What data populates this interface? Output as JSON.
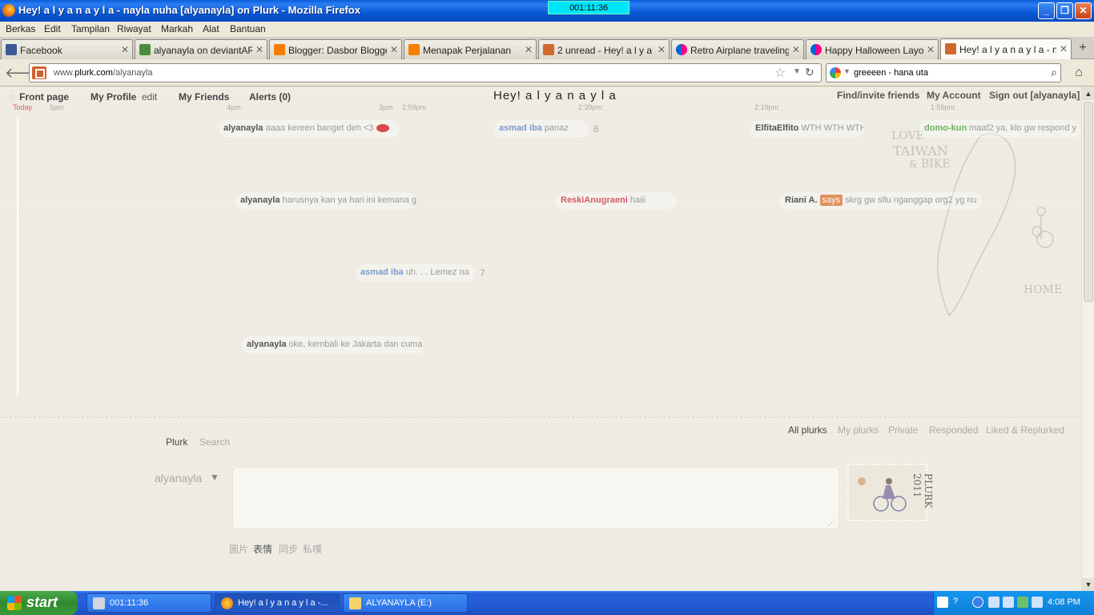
{
  "window": {
    "title": "Hey! a l y a n a y l a - nayla nuha [alyanayla] on Plurk - Mozilla Firefox",
    "timer": "001:11:36"
  },
  "menu": [
    "Berkas",
    "Edit",
    "Tampilan",
    "Riwayat",
    "Markah",
    "Alat",
    "Bantuan"
  ],
  "tabs": [
    {
      "label": "Facebook",
      "icon": "facebook-icon",
      "color": "#3b5998"
    },
    {
      "label": "alyanayla on deviantART",
      "icon": "deviantart-icon",
      "color": "#4a8c3b"
    },
    {
      "label": "Blogger: Dasbor Blogger",
      "icon": "blogger-icon",
      "color": "#f57d00"
    },
    {
      "label": "Menapak Perjalanan",
      "icon": "blogger-icon",
      "color": "#f57d00"
    },
    {
      "label": "2 unread - Hey! a l y a ...",
      "icon": "plurk-icon",
      "color": "#cf682f"
    },
    {
      "label": "Retro Airplane traveling...",
      "icon": "flickr-icon",
      "color": "#ff0084"
    },
    {
      "label": "Happy Halloween Layou...",
      "icon": "flickr-icon",
      "color": "#ff0084"
    },
    {
      "label": "Hey! a l y a n a y l a - n...",
      "icon": "plurk-icon",
      "color": "#cf682f"
    }
  ],
  "nav": {
    "url_prefix": "www.",
    "url_host": "plurk.com",
    "url_path": "/alyanayla",
    "search_value": "greeeen - hana uta"
  },
  "plurk": {
    "nav": {
      "front_page": "Front page",
      "my_profile": "My Profile",
      "edit": "edit",
      "my_friends": "My Friends",
      "alerts": "Alerts (0)"
    },
    "page_title": "Hey! a l y a n a y l a",
    "account_links": {
      "find_friends": "Find/invite friends",
      "my_account": "My Account",
      "sign_out": "Sign out [alyanayla]"
    },
    "timeline": {
      "today": "Today",
      "labels": [
        "5pm",
        "4pm",
        "3pm",
        "2:59pm",
        "2:39pm",
        "2:19pm",
        "1:59pm"
      ]
    },
    "plurks": [
      {
        "name": "alyanayla",
        "text": "aaaa kereen banget deh <3",
        "style": "normal",
        "count": ""
      },
      {
        "name": "asmad iba",
        "text": "panaz",
        "style": "blue",
        "count": "6"
      },
      {
        "name": "ElfitaElfito",
        "text": "WTH WTH WTH",
        "style": "normal",
        "count": ""
      },
      {
        "name": "domo-kun",
        "text": "maaf2 ya, klo gw respond y",
        "style": "green",
        "count": ""
      },
      {
        "name": "alyanayla",
        "text": "harusnya kan ya hari ini kemana g",
        "style": "normal",
        "count": ""
      },
      {
        "name": "ReskiAnugraeni",
        "text": "haiii",
        "style": "red",
        "count": ""
      },
      {
        "name": "Riani A.",
        "verb": "says",
        "text": "skrg gw sllu nganggap org2 yg nu",
        "style": "normal",
        "count": ""
      },
      {
        "name": "asmad iba",
        "text": "uh. . . Lemez na",
        "style": "blue",
        "count": "7"
      },
      {
        "name": "alyanayla",
        "text": "oke, kembali ke Jakarta dan cuma",
        "style": "normal",
        "count": ""
      }
    ],
    "decor_text": {
      "love": "LOVE",
      "taiwan": "TAIWAN",
      "amp": "&",
      "bike": "BIKE",
      "home": "HOME"
    },
    "bottom_tabs": {
      "plurk": "Plurk",
      "search": "Search"
    },
    "filters": [
      "All plurks",
      "My plurks",
      "Private",
      "Responded",
      "Liked & Replurked"
    ],
    "composer": {
      "username": "alyanayla",
      "options": [
        "圖片",
        "表情",
        "同步",
        "私噗"
      ],
      "stamp_text": "PLURK",
      "stamp_year": "2011"
    }
  },
  "taskbar": {
    "start": "start",
    "tasks": [
      {
        "label": "001:11:36",
        "icon": "monitor-icon"
      },
      {
        "label": "Hey! a l y a n a y l a -...",
        "icon": "firefox-icon"
      },
      {
        "label": "ALYANAYLA (E:)",
        "icon": "folder-icon"
      }
    ],
    "clock": "4:08 PM"
  },
  "colors": {
    "titlebar": "#0a58d4",
    "page_bg": "#f0ede4",
    "taskbar": "#245edb",
    "start": "#3a9a3a"
  }
}
